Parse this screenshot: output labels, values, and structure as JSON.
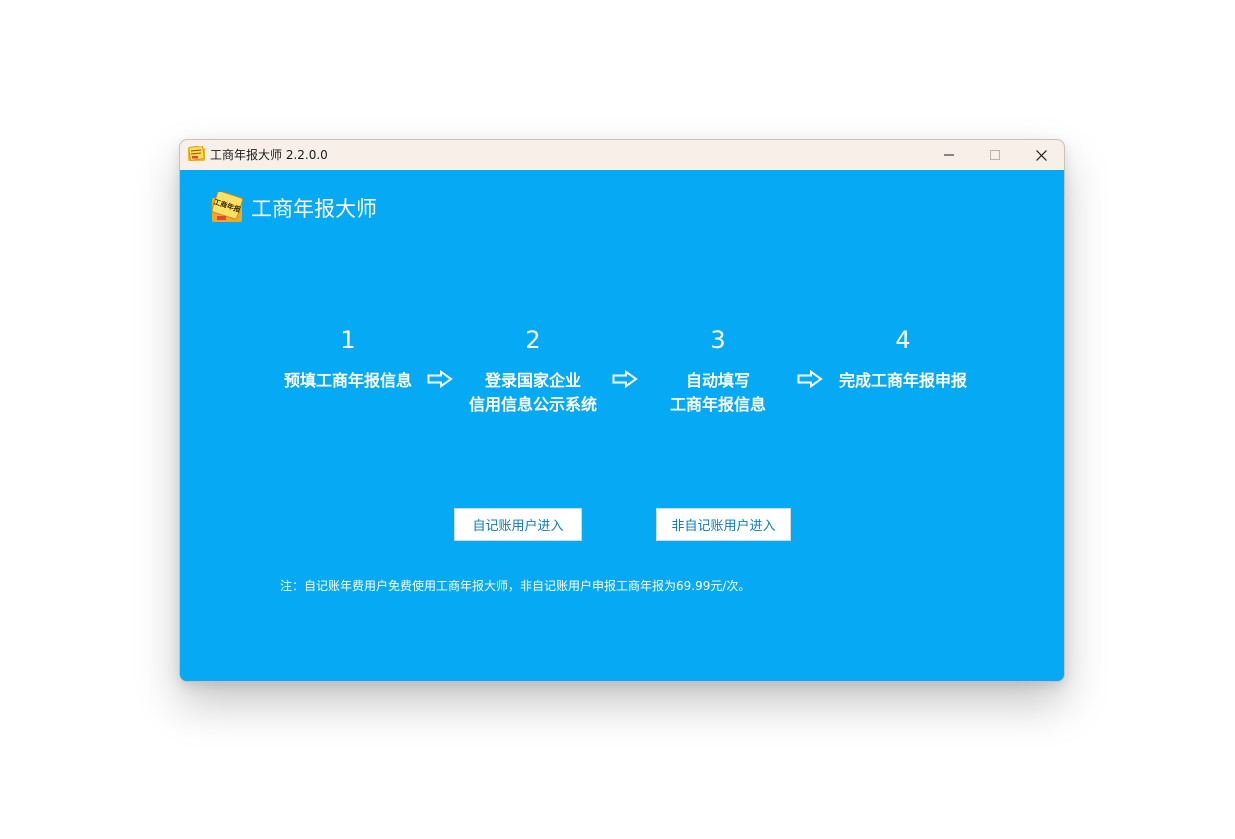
{
  "window": {
    "title": "工商年报大师 2.2.0.0",
    "controls": {
      "minimize": "minimize-icon",
      "maximize": "maximize-icon",
      "close": "close-icon"
    }
  },
  "app": {
    "brand_title": "工商年报大师",
    "icon": "app-logo-icon",
    "icon_text": "工商年报"
  },
  "steps": [
    {
      "num": "1",
      "lines": [
        "预填工商年报信息"
      ]
    },
    {
      "num": "2",
      "lines": [
        "登录国家企业",
        "信用信息公示系统"
      ]
    },
    {
      "num": "3",
      "lines": [
        "自动填写",
        "工商年报信息"
      ]
    },
    {
      "num": "4",
      "lines": [
        "完成工商年报申报"
      ]
    }
  ],
  "arrow_icon": "right-arrow-outline-icon",
  "buttons": {
    "self_bookkeeping": "自记账用户进入",
    "non_self_bookkeeping": "非自记账用户进入"
  },
  "note": "注：自记账年费用户免费使用工商年报大师，非自记账用户申报工商年报为69.99元/次。",
  "colors": {
    "accent": "#05a9f4",
    "titlebar": "#f8efe9",
    "button_text": "#0a7bc4"
  }
}
